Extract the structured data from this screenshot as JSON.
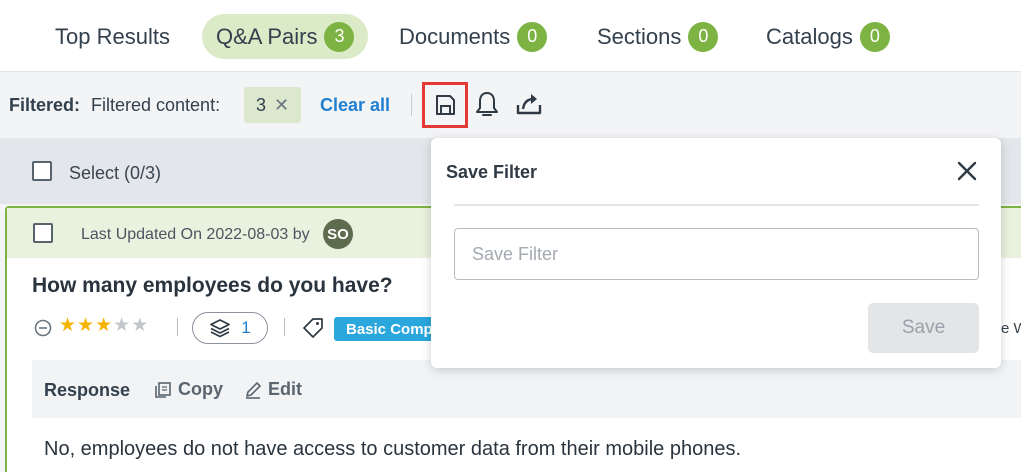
{
  "tabs": [
    {
      "label": "Top Results",
      "count": null,
      "active": false
    },
    {
      "label": "Q&A Pairs",
      "count": "3",
      "active": true
    },
    {
      "label": "Documents",
      "count": "0",
      "active": false
    },
    {
      "label": "Sections",
      "count": "0",
      "active": false
    },
    {
      "label": "Catalogs",
      "count": "0",
      "active": false
    }
  ],
  "filterbar": {
    "filtered_label": "Filtered:",
    "content_label": "Filtered content:",
    "chip_value": "3",
    "chip_remove_icon": "close-icon",
    "clear_all": "Clear all",
    "save_icon": "save-disk-icon",
    "bell_icon": "bell-icon",
    "share_icon": "share-upload-icon"
  },
  "select": {
    "label": "Select (0/3)"
  },
  "card": {
    "last_updated": "Last Updated On 2022-08-03 by",
    "avatar_initials": "SO",
    "question": "How many employees do you have?",
    "rating": {
      "value": 3,
      "max": 5
    },
    "layer_count": "1",
    "tag": "Basic Comp",
    "right_clip": "e W",
    "response": {
      "label": "Response",
      "copy": "Copy",
      "edit": "Edit"
    },
    "answer": "No, employees do not have access to customer data from their mobile phones."
  },
  "save_filter": {
    "title": "Save Filter",
    "input_placeholder": "Save Filter",
    "input_value": "",
    "save_button": "Save"
  },
  "colors": {
    "accent_green": "#7cb342",
    "active_tab_bg": "#dcebc7",
    "link_blue": "#1f7fd0",
    "highlight_red": "#e53935",
    "tag_blue": "#2aa7dd",
    "star_gold": "#f5b400"
  }
}
